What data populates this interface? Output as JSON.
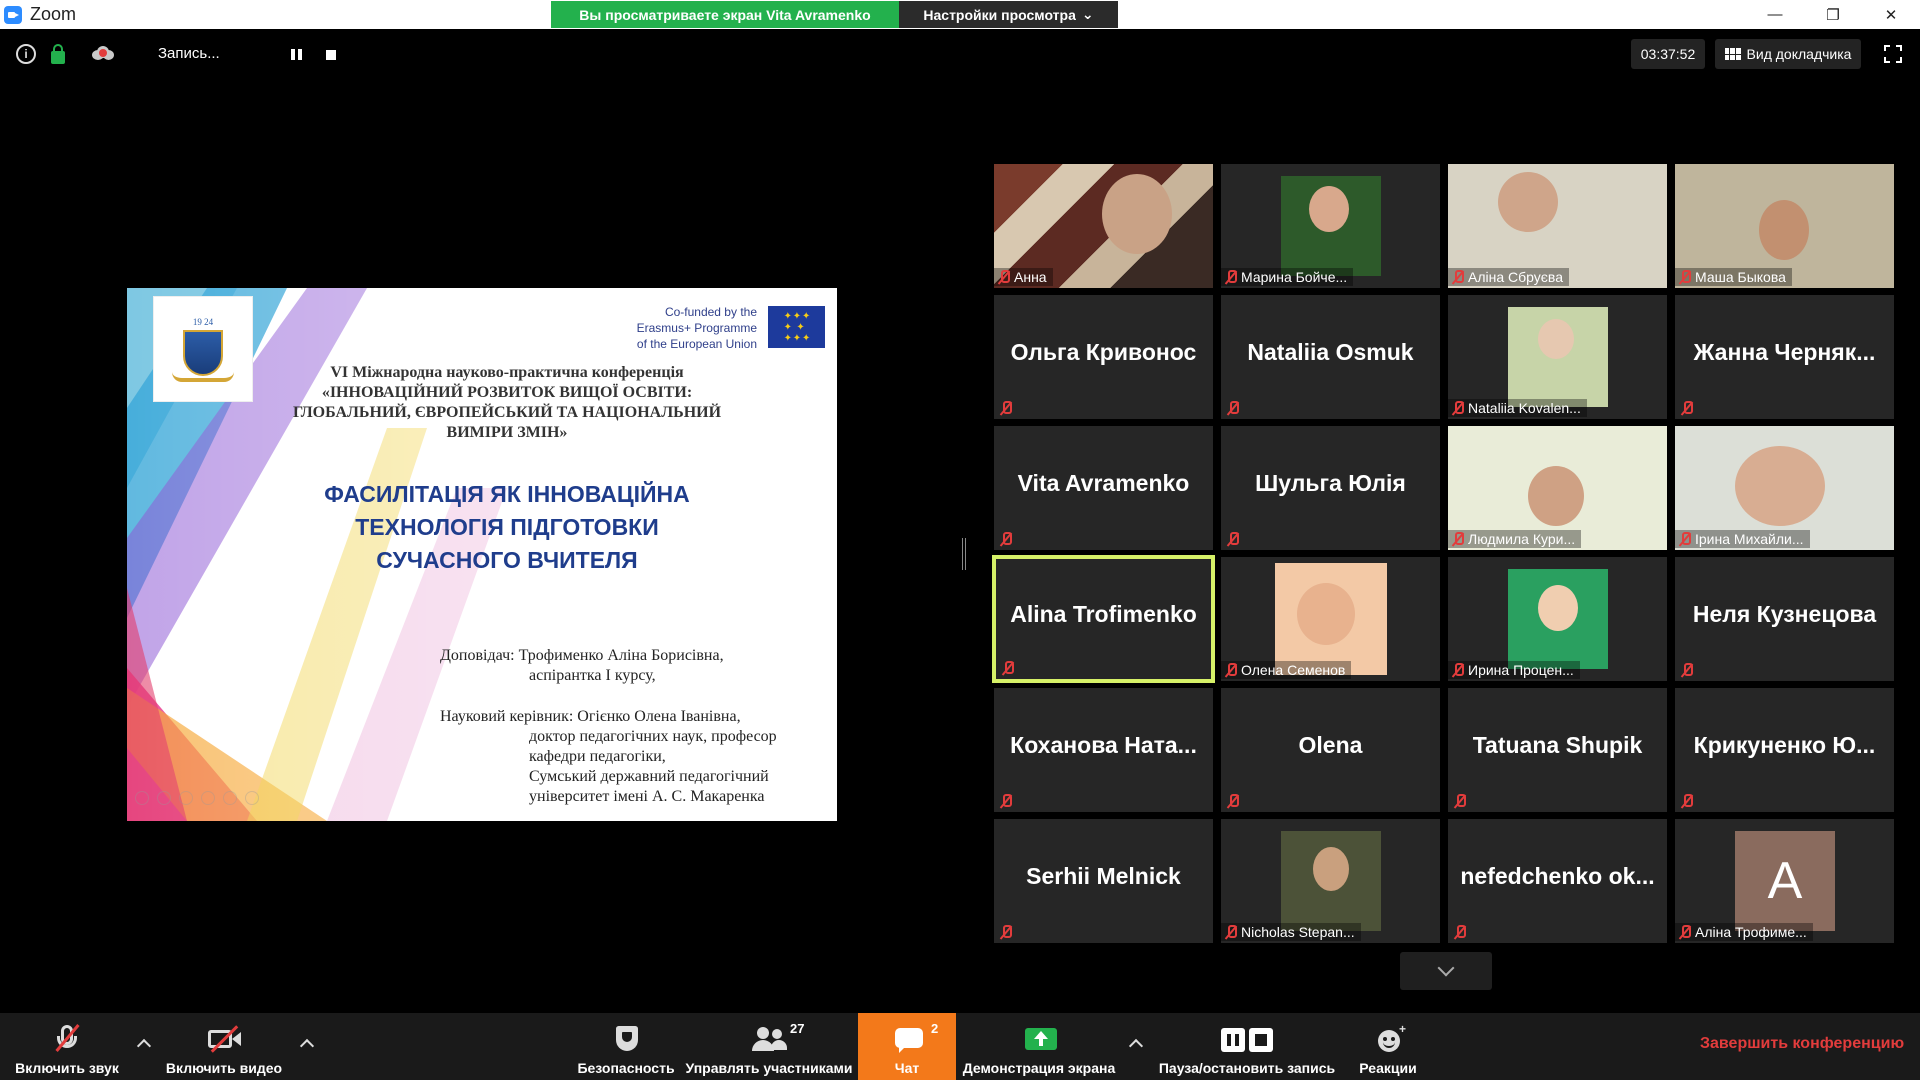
{
  "window": {
    "app_name": "Zoom",
    "share_banner": "Вы просматриваете экран Vita Avramenko",
    "view_options": "Настройки просмотра",
    "minimize": "—",
    "restore": "❐",
    "close": "✕"
  },
  "topbar": {
    "info": "i",
    "recording_label": "Запись...",
    "timer": "03:37:52",
    "speaker_view": "Вид докладчика"
  },
  "slide": {
    "eu_line1": "Co-funded by the",
    "eu_line2": "Erasmus+ Programme",
    "eu_line3": "of the European Union",
    "logo_year": "19 24",
    "conf_line1": "VI Міжнародна науково-практична конференція",
    "conf_line2": "«ІННОВАЦІЙНИЙ РОЗВИТОК ВИЩОЇ ОСВІТИ:",
    "conf_line3": "ГЛОБАЛЬНИЙ, ЄВРОПЕЙСЬКИЙ ТА НАЦІОНАЛЬНИЙ",
    "conf_line4": "ВИМІРИ ЗМІН»",
    "talk_line1": "ФАСИЛІТАЦІЯ ЯК ІННОВАЦІЙНА",
    "talk_line2": "ТЕХНОЛОГІЯ ПІДГОТОВКИ",
    "talk_line3": "СУЧАСНОГО ВЧИТЕЛЯ",
    "speaker_line1": "Доповідач: Трофименко Аліна Борисівна,",
    "speaker_line2": "аспірантка І курсу,",
    "advisor_line1": "Науковий керівник: Огієнко Олена Іванівна,",
    "advisor_line2": "доктор педагогічних наук, професор",
    "advisor_line3": "кафедри педагогіки,",
    "advisor_line4": "Сумський державний педагогічний",
    "advisor_line5": "університет імені А. С. Макаренка"
  },
  "participants": [
    {
      "name": "Анна",
      "kind": "video"
    },
    {
      "name": "Марина Бойче...",
      "kind": "video"
    },
    {
      "name": "Аліна Сбруєва",
      "kind": "video"
    },
    {
      "name": "Маша Быкова",
      "kind": "video"
    },
    {
      "name": "Ольга Кривонос",
      "kind": "name"
    },
    {
      "name": "Nataliia Osmuk",
      "kind": "name"
    },
    {
      "name": "Nataliia Kovalen...",
      "kind": "video"
    },
    {
      "name": "Жанна Черняк...",
      "kind": "name"
    },
    {
      "name": "Vita Avramenko",
      "kind": "name"
    },
    {
      "name": "Шульга Юлія",
      "kind": "name"
    },
    {
      "name": "Людмила Кури...",
      "kind": "video"
    },
    {
      "name": "Ірина Михайли...",
      "kind": "video"
    },
    {
      "name": "Alina Trofimenko",
      "kind": "name",
      "active": true
    },
    {
      "name": "Олена Семенов",
      "kind": "video"
    },
    {
      "name": "Ирина Процен...",
      "kind": "video"
    },
    {
      "name": "Неля Кузнецова",
      "kind": "name"
    },
    {
      "name": "Коханова Ната...",
      "kind": "name"
    },
    {
      "name": "Olena",
      "kind": "name"
    },
    {
      "name": "Tatuana Shupik",
      "kind": "name"
    },
    {
      "name": "Крикуненко Ю...",
      "kind": "name"
    },
    {
      "name": "Serhii Melnick",
      "kind": "name"
    },
    {
      "name": "Nicholas Stepan...",
      "kind": "video"
    },
    {
      "name": "nefedchenko ok...",
      "kind": "name"
    },
    {
      "name": "Аліна Трофиме...",
      "kind": "avatar",
      "letter": "A"
    }
  ],
  "toolbar": {
    "unmute": "Включить звук",
    "start_video": "Включить видео",
    "security": "Безопасность",
    "participants": "Управлять участниками",
    "participants_count": "27",
    "chat": "Чат",
    "chat_count": "2",
    "share_screen": "Демонстрация экрана",
    "pause_record": "Пауза/остановить запись",
    "reactions": "Реакции",
    "end": "Завершить конференцию"
  },
  "colors": {
    "share_green": "#23b14d",
    "chat_orange": "#f3791a",
    "end_red": "#e23c3c",
    "active_speaker": "#d6f168",
    "tile_bg": "#262626"
  }
}
